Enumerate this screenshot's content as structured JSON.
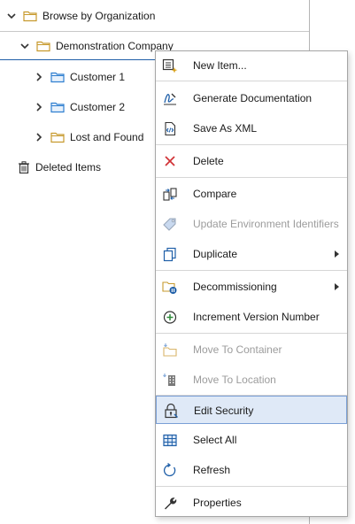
{
  "tree": {
    "root": {
      "label": "Browse by Organization",
      "icon": "folder-icon"
    },
    "company": {
      "label": "Demonstration Company",
      "icon": "folder-icon"
    },
    "children": [
      {
        "label": "Customer 1",
        "icon": "blue-folder-icon"
      },
      {
        "label": "Customer 2",
        "icon": "blue-folder-icon"
      },
      {
        "label": "Lost and Found",
        "icon": "folder-icon"
      }
    ],
    "deleted": {
      "label": "Deleted Items",
      "icon": "trash-icon"
    }
  },
  "menu": {
    "items": [
      {
        "label": "New Item...",
        "icon": "new-item-icon",
        "enabled": true
      },
      {
        "label": "Generate Documentation",
        "icon": "signature-icon",
        "enabled": true
      },
      {
        "label": "Save As XML",
        "icon": "xml-icon",
        "enabled": true
      },
      {
        "label": "Delete",
        "icon": "delete-x-icon",
        "enabled": true
      },
      {
        "label": "Compare",
        "icon": "compare-icon",
        "enabled": true
      },
      {
        "label": "Update Environment Identifiers",
        "icon": "tag-icon",
        "enabled": false
      },
      {
        "label": "Duplicate",
        "icon": "duplicate-icon",
        "enabled": true,
        "submenu": true
      },
      {
        "label": "Decommissioning",
        "icon": "decommission-icon",
        "enabled": true,
        "submenu": true
      },
      {
        "label": "Increment Version Number",
        "icon": "plus-circle-icon",
        "enabled": true
      },
      {
        "label": "Move To Container",
        "icon": "move-container-icon",
        "enabled": false
      },
      {
        "label": "Move To Location",
        "icon": "building-icon",
        "enabled": false
      },
      {
        "label": "Edit Security",
        "icon": "lock-icon",
        "enabled": true,
        "highlighted": true
      },
      {
        "label": "Select All",
        "icon": "grid-icon",
        "enabled": true
      },
      {
        "label": "Refresh",
        "icon": "refresh-icon",
        "enabled": true
      },
      {
        "label": "Properties",
        "icon": "wrench-icon",
        "enabled": true
      }
    ]
  },
  "colors": {
    "accent": "#1f5fa8",
    "folder": "#c79a2e",
    "blue_folder": "#2f7fd0",
    "delete_red": "#d13438",
    "disabled_text": "#9c9c9c",
    "highlight_bg": "#dfe9f7"
  }
}
